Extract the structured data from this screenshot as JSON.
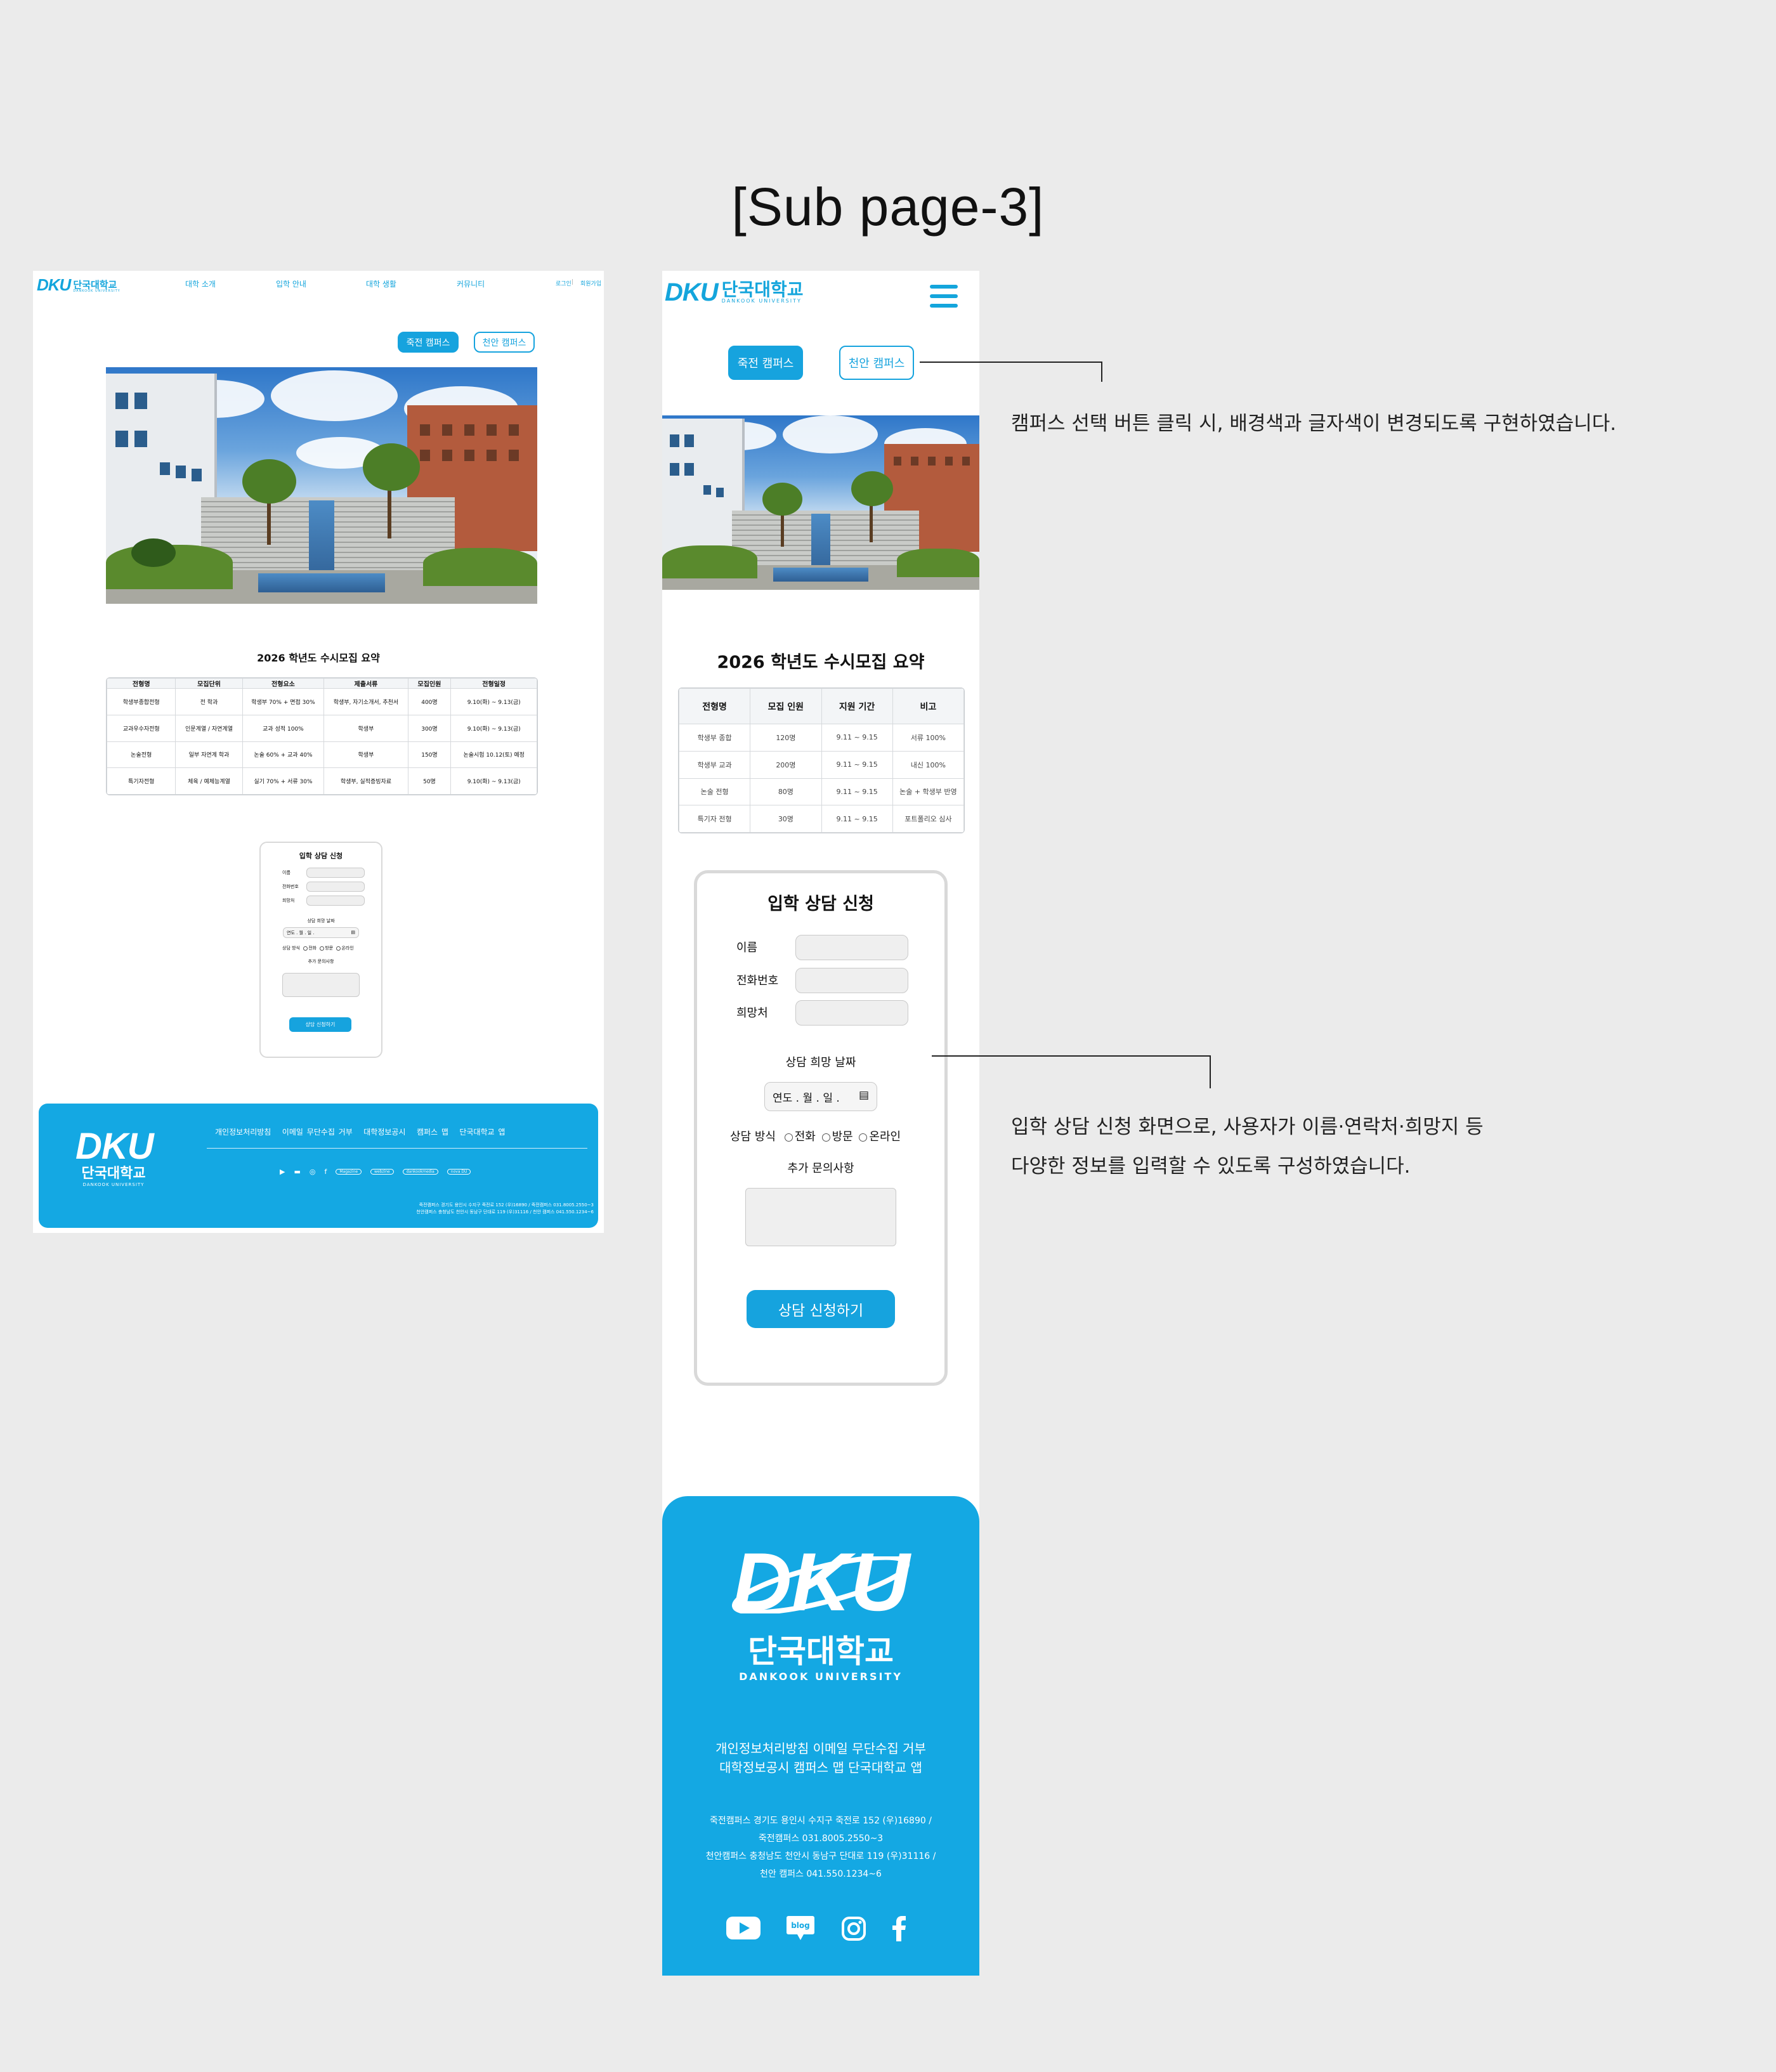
{
  "page_title": "[Sub page-3]",
  "brand": {
    "mark": "DKU",
    "name_ko": "단국대학교",
    "name_en": "DANKOOK UNIVERSITY",
    "color": "#14a8e3"
  },
  "desktop": {
    "nav": [
      "대학 소개",
      "입학 안내",
      "대학 생활",
      "커뮤니티"
    ],
    "util": {
      "login": "로그인",
      "signup": "회원가입"
    },
    "campus": {
      "jukjeon": "죽전 캠퍼스",
      "cheonan": "천안 캠퍼스"
    },
    "summary_title": "2026 학년도 수시모집 요약",
    "table": {
      "headers": [
        "전형명",
        "모집단위",
        "전형요소",
        "제출서류",
        "모집인원",
        "전형일정"
      ],
      "rows": [
        [
          "학생부종합전형",
          "전 학과",
          "학생부 70% + 면접 30%",
          "학생부, 자기소개서, 추천서",
          "400명",
          "9.10(화) ~ 9.13(금)"
        ],
        [
          "교과우수자전형",
          "인문계열 / 자연계열",
          "교과 성적 100%",
          "학생부",
          "300명",
          "9.10(화) ~ 9.13(금)"
        ],
        [
          "논술전형",
          "일부 자연계 학과",
          "논술 60% + 교과 40%",
          "학생부",
          "150명",
          "논술시험 10.12(토) 예정"
        ],
        [
          "특기자전형",
          "체육 / 예체능계열",
          "실기 70% + 서류 30%",
          "학생부, 실적증빙자료",
          "50명",
          "9.10(화) ~ 9.13(금)"
        ]
      ]
    },
    "form": {
      "title": "입학 상담 신청",
      "name_label": "이름",
      "phone_label": "전화번호",
      "hope_label": "희망처",
      "date_label": "상담 희망 날짜",
      "date_placeholder": "연도 . 월 . 일 .",
      "method_label": "상담 방식",
      "methods": [
        "전화",
        "방문",
        "온라인"
      ],
      "extra_label": "추가 문의사항",
      "submit": "상담 신청하기"
    },
    "footer": {
      "links": [
        "개인정보처리방침",
        "이메일 무단수집 거부",
        "대학정보공시",
        "캠퍼스 맵",
        "단국대학교 앱"
      ],
      "partners": [
        "Magazine",
        "webzine",
        "dankookmedia",
        "nova DU"
      ],
      "address_1": "죽전캠퍼스 경기도 용인시 수지구 죽전로 152 (우)16890 / 죽전캠퍼스 031.8005.2550~3",
      "address_2": "천안캠퍼스 충청남도 천안시 동남구 단대로 119 (우)31116 / 천안 캠퍼스 041.550.1234~6"
    }
  },
  "mobile": {
    "campus": {
      "jukjeon": "죽전 캠퍼스",
      "cheonan": "천안 캠퍼스"
    },
    "summary_title": "2026 학년도 수시모집 요약",
    "table": {
      "headers": [
        "전형명",
        "모집 인원",
        "지원 기간",
        "비고"
      ],
      "rows": [
        [
          "학생부 종합",
          "120명",
          "9.11 ~ 9.15",
          "서류 100%"
        ],
        [
          "학생부 교과",
          "200명",
          "9.11 ~ 9.15",
          "내신 100%"
        ],
        [
          "논술 전형",
          "80명",
          "9.11 ~ 9.15",
          "논술 + 학생부 반영"
        ],
        [
          "특기자 전형",
          "30명",
          "9.11 ~ 9.15",
          "포트폴리오 심사"
        ]
      ]
    },
    "form": {
      "title": "입학 상담 신청",
      "name_label": "이름",
      "phone_label": "전화번호",
      "hope_label": "희망처",
      "date_label": "상담 희망 날짜",
      "date_placeholder": "연도 . 월 . 일 .",
      "method_label": "상담 방식",
      "methods": [
        "전화",
        "방문",
        "온라인"
      ],
      "extra_label": "추가 문의사항",
      "submit": "상담 신청하기"
    },
    "footer": {
      "links_line1": "개인정보처리방침  이메일 무단수집 거부",
      "links_line2": "대학정보공시  캠퍼스 맵  단국대학교 앱",
      "address_lines": [
        "죽전캠퍼스 경기도 용인시 수지구 죽전로 152 (우)16890 /",
        "죽전캠퍼스 031.8005.2550~3",
        "천안캠퍼스 충청남도 천안시 동남구 단대로 119 (우)31116 /",
        "천안 캠퍼스 041.550.1234~6"
      ],
      "blog": "blog"
    }
  },
  "annotations": {
    "campus_button": "캠퍼스 선택 버튼 클릭 시, 배경색과 글자색이 변경되도록 구현하였습니다.",
    "form_line1": "입학 상담 신청 화면으로, 사용자가 이름·연락처·희망지 등",
    "form_line2": "다양한 정보를 입력할 수 있도록 구성하였습니다."
  }
}
